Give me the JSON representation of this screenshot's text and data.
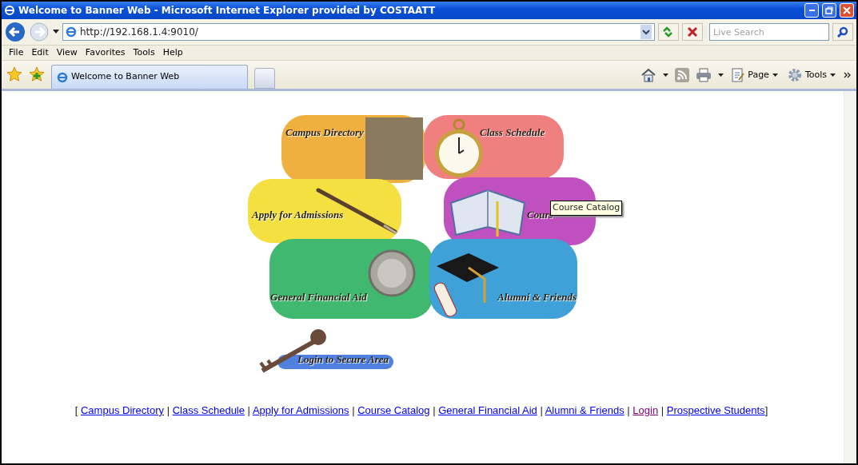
{
  "window": {
    "title": "Welcome to Banner Web - Microsoft Internet Explorer provided by COSTAATT"
  },
  "address_bar": {
    "url": "http://192.168.1.4:9010/"
  },
  "search": {
    "placeholder": "Live Search"
  },
  "menu_bar": [
    "File",
    "Edit",
    "View",
    "Favorites",
    "Tools",
    "Help"
  ],
  "tabs": [
    {
      "label": "Welcome to Banner Web",
      "selected": true
    }
  ],
  "command_bar": [
    "Page",
    "Tools"
  ],
  "image_map": [
    {
      "label": "Campus Directory",
      "kind": "people",
      "color": "#f0b040"
    },
    {
      "label": "Class Schedule",
      "kind": "watch",
      "color": "#f08080"
    },
    {
      "label": "Apply for Admissions",
      "kind": "pen",
      "color": "#f4e040"
    },
    {
      "label": "Cours",
      "kind": "book",
      "color": "#c050c0"
    },
    {
      "label": "General Financial Aid",
      "kind": "coin",
      "color": "#40b870"
    },
    {
      "label": "Alumni & Friends",
      "kind": "cap",
      "color": "#40a0d8"
    },
    {
      "label": "Login to Secure Area",
      "kind": "key",
      "color": "#5080e0"
    }
  ],
  "tooltip": "Course Catalog",
  "footer": {
    "open": "[",
    "separator": "|",
    "close": "]",
    "links": [
      {
        "label": "Campus Directory",
        "visited": false
      },
      {
        "label": "Class Schedule",
        "visited": false
      },
      {
        "label": "Apply for Admissions",
        "visited": false
      },
      {
        "label": "Course Catalog",
        "visited": false
      },
      {
        "label": "General Financial Aid",
        "visited": false
      },
      {
        "label": "Alumni & Friends",
        "visited": false
      },
      {
        "label": "Login",
        "visited": true
      },
      {
        "label": "Prospective Students",
        "visited": false
      }
    ]
  }
}
